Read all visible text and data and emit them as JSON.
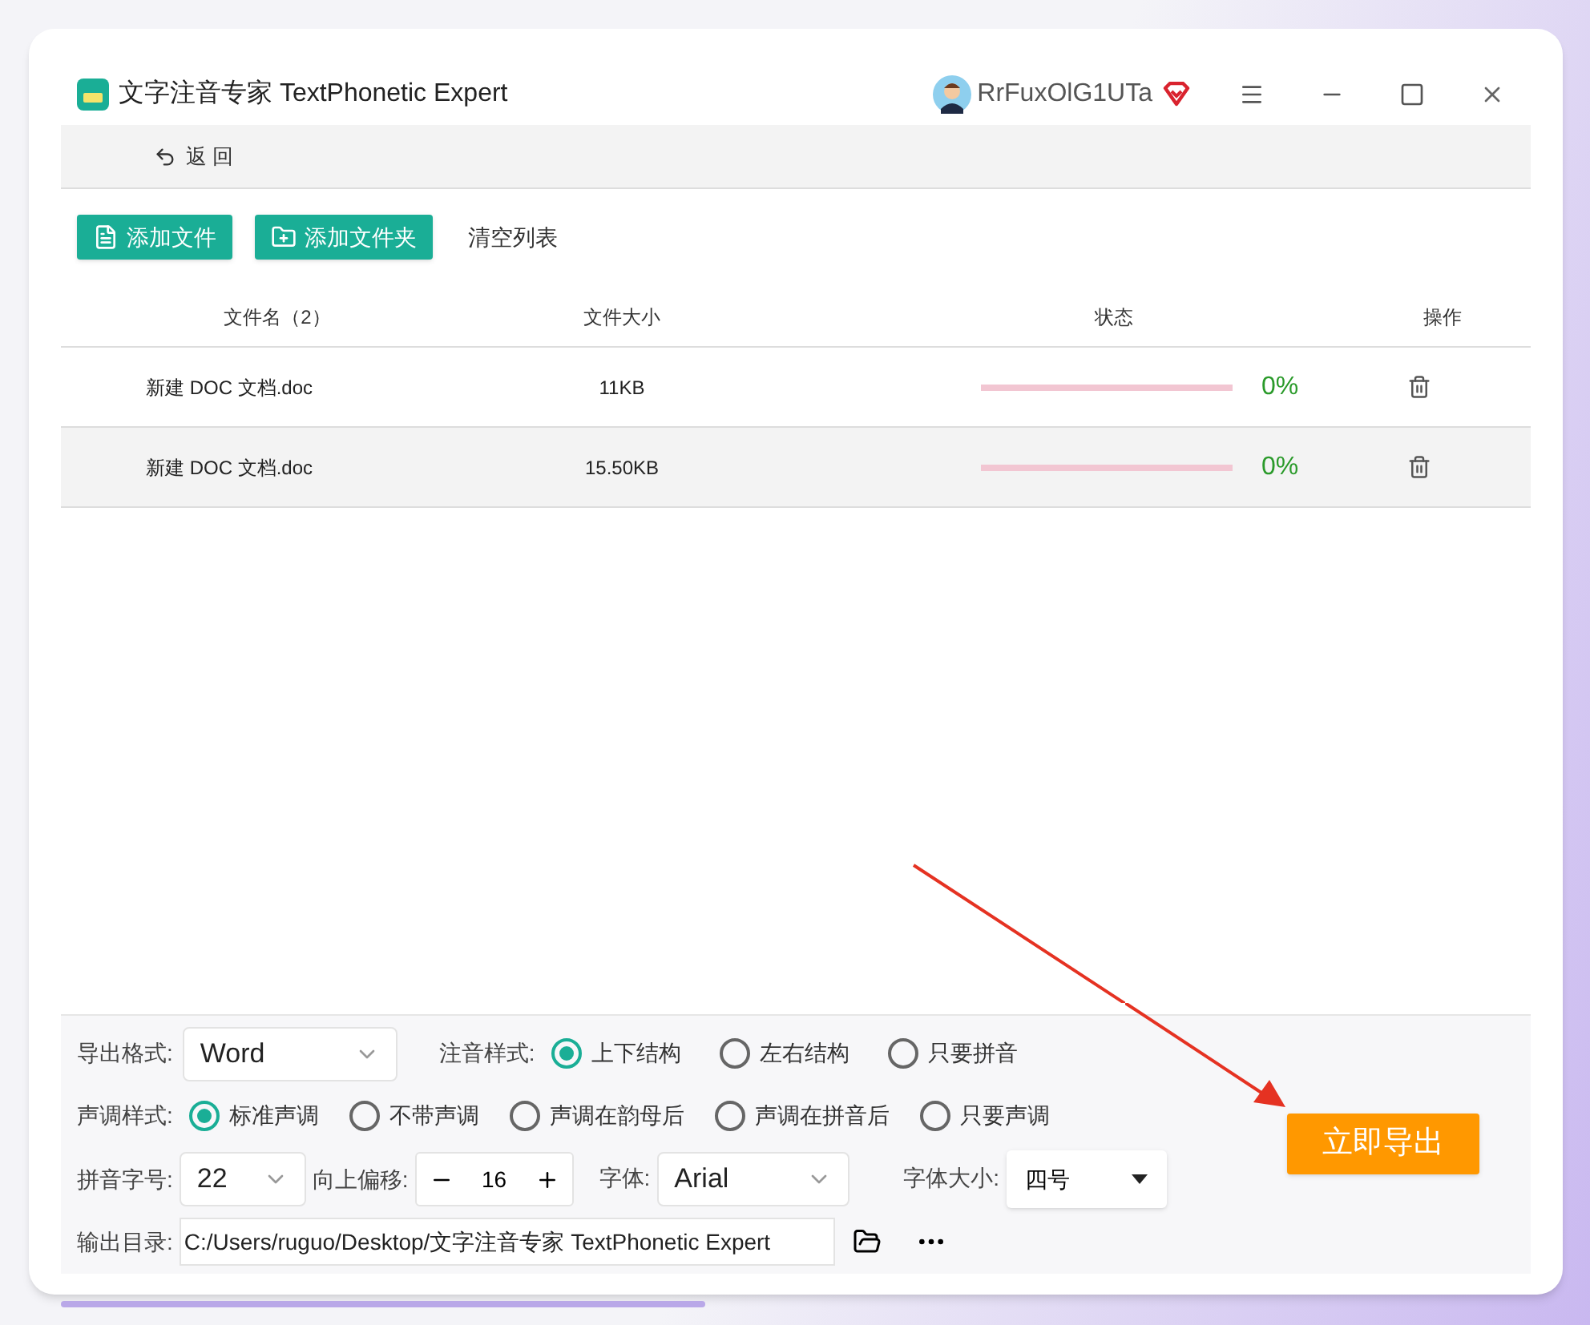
{
  "window": {
    "title": "文字注音专家 TextPhonetic Expert",
    "username": "RrFuxOlG1UTa"
  },
  "toolbar": {
    "back": "返 回"
  },
  "actions": [
    {
      "kind": "file",
      "label": "添加文件"
    },
    {
      "kind": "folder",
      "label": "添加文件夹"
    },
    {
      "kind": "plain",
      "label": "清空列表"
    }
  ],
  "table": {
    "columns": [
      "文件名（2）",
      "文件大小",
      "状态",
      "操作"
    ],
    "rows": [
      {
        "name": "新建 DOC 文档.doc",
        "size": "11KB",
        "percent": "0%",
        "selected": false
      },
      {
        "name": "新建 DOC 文档.doc",
        "size": "15.50KB",
        "percent": "0%",
        "selected": true
      }
    ]
  },
  "settings": {
    "export_format": {
      "label": "导出格式:",
      "value": "Word"
    },
    "annotation_style": {
      "label": "注音样式:",
      "options": [
        {
          "label": "上下结构",
          "selected": true
        },
        {
          "label": "左右结构",
          "selected": false
        },
        {
          "label": "只要拼音",
          "selected": false
        }
      ]
    },
    "tone_style": {
      "label": "声调样式:",
      "options": [
        {
          "label": "标准声调",
          "selected": true
        },
        {
          "label": "不带声调",
          "selected": false
        },
        {
          "label": "声调在韵母后",
          "selected": false
        },
        {
          "label": "声调在拼音后",
          "selected": false
        },
        {
          "label": "只要声调",
          "selected": false
        }
      ]
    },
    "pinyin_size": {
      "label": "拼音字号:",
      "value": "22"
    },
    "offset": {
      "label": "向上偏移:",
      "value": "16"
    },
    "font": {
      "label": "字体:",
      "value": "Arial"
    },
    "font_size": {
      "label": "字体大小:",
      "value": "四号"
    },
    "output_dir": {
      "label": "输出目录:",
      "value": "C:/Users/ruguo/Desktop/文字注音专家 TextPhonetic Expert"
    }
  },
  "export_button": "立即导出"
}
